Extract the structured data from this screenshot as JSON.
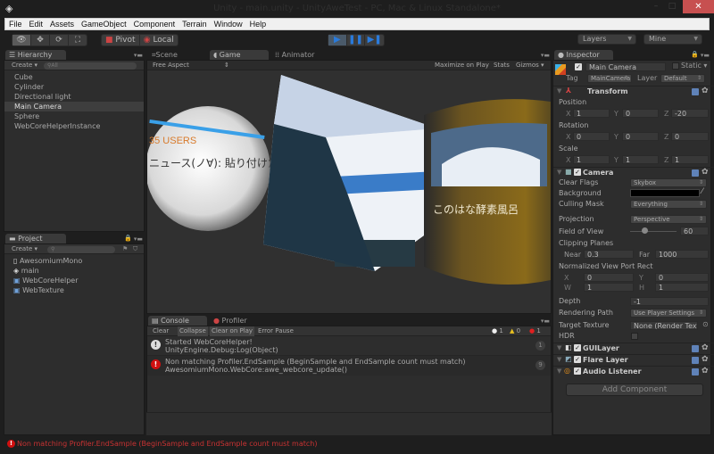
{
  "window": {
    "title": "Unity - main.unity - UnityAweTest - PC, Mac & Linux Standalone*",
    "close_icon": "✕",
    "minimize_icon": "–",
    "maximize_icon": "□"
  },
  "menu": [
    "File",
    "Edit",
    "Assets",
    "GameObject",
    "Component",
    "Terrain",
    "Window",
    "Help"
  ],
  "toolbar": {
    "tools": [
      "👁",
      "✥",
      "⟳",
      "⛶"
    ],
    "pivot": "Pivot",
    "local": "Local",
    "play": "▶",
    "pause": "❚❚",
    "step": "▶❚",
    "layers": "Layers",
    "layout": "Mine"
  },
  "hierarchy": {
    "tab": "Hierarchy",
    "create": "Create",
    "search_placeholder": "All",
    "items": [
      "Cube",
      "Cylinder",
      "Directional light",
      "Main Camera",
      "Sphere",
      "WebCoreHelperInstance"
    ],
    "selected": "Main Camera"
  },
  "project": {
    "tab": "Project",
    "create": "Create",
    "items": [
      {
        "name": "AwesomiumMono",
        "icon": "file-icon"
      },
      {
        "name": "main",
        "icon": "unity-scene-icon"
      },
      {
        "name": "WebCoreHelper",
        "icon": "csharp-script-icon"
      },
      {
        "name": "WebTexture",
        "icon": "csharp-script-icon"
      }
    ]
  },
  "viewport": {
    "tabs": [
      "Scene",
      "Game",
      "Animator"
    ],
    "active_tab": "Game",
    "aspect": "Free Aspect",
    "maximize": "Maximize on Play",
    "stats": "Stats",
    "gizmos": "Gizmos",
    "texts": {
      "users": "35 USERS",
      "sphere_jp": "ニュース(ノ∀): 貼り付けた写真",
      "cyl_jp": "このはな酵素風呂"
    }
  },
  "console": {
    "tabs": [
      "Console",
      "Profiler"
    ],
    "buttons": [
      "Clear",
      "Collapse",
      "Clear on Play",
      "Error Pause"
    ],
    "counts": {
      "info": "1",
      "warn": "0",
      "error": "1"
    },
    "entries": [
      {
        "type": "info",
        "line1": "Started WebCoreHelper!",
        "line2": "UnityEngine.Debug:Log(Object)",
        "count": "1"
      },
      {
        "type": "error",
        "line1": "Non matching Profiler.EndSample (BeginSample and EndSample count must match)",
        "line2": "AwesomiumMono.WebCore:awe_webcore_update()",
        "count": "9"
      }
    ]
  },
  "status": {
    "message": "Non matching Profiler.EndSample (BeginSample and EndSample count must match)",
    "color": "#c83232"
  },
  "inspector": {
    "tab": "Inspector",
    "object_name": "Main Camera",
    "static": "Static",
    "tag_label": "Tag",
    "tag": "MainCamera",
    "layer_label": "Layer",
    "layer": "Default",
    "transform": {
      "title": "Transform",
      "position_label": "Position",
      "rotation_label": "Rotation",
      "scale_label": "Scale",
      "position": {
        "x": "1",
        "y": "0",
        "z": "-20"
      },
      "rotation": {
        "x": "0",
        "y": "0",
        "z": "0"
      },
      "scale": {
        "x": "1",
        "y": "1",
        "z": "1"
      }
    },
    "camera": {
      "title": "Camera",
      "clear_flags_label": "Clear Flags",
      "clear_flags": "Skybox",
      "background_label": "Background",
      "culling_label": "Culling Mask",
      "culling": "Everything",
      "projection_label": "Projection",
      "projection": "Perspective",
      "fov_label": "Field of View",
      "fov": "60",
      "fov_slider_fraction": 0.3,
      "clipping_label": "Clipping Planes",
      "near_label": "Near",
      "near": "0.3",
      "far_label": "Far",
      "far": "1000",
      "viewport_label": "Normalized View Port Rect",
      "vx": "0",
      "vy": "0",
      "vw": "1",
      "vh": "1",
      "depth_label": "Depth",
      "depth": "-1",
      "rendering_label": "Rendering Path",
      "rendering": "Use Player Settings",
      "target_label": "Target Texture",
      "target": "None (Render Text",
      "hdr_label": "HDR"
    },
    "components": [
      "GUILayer",
      "Flare Layer",
      "Audio Listener"
    ],
    "add_component": "Add Component"
  }
}
